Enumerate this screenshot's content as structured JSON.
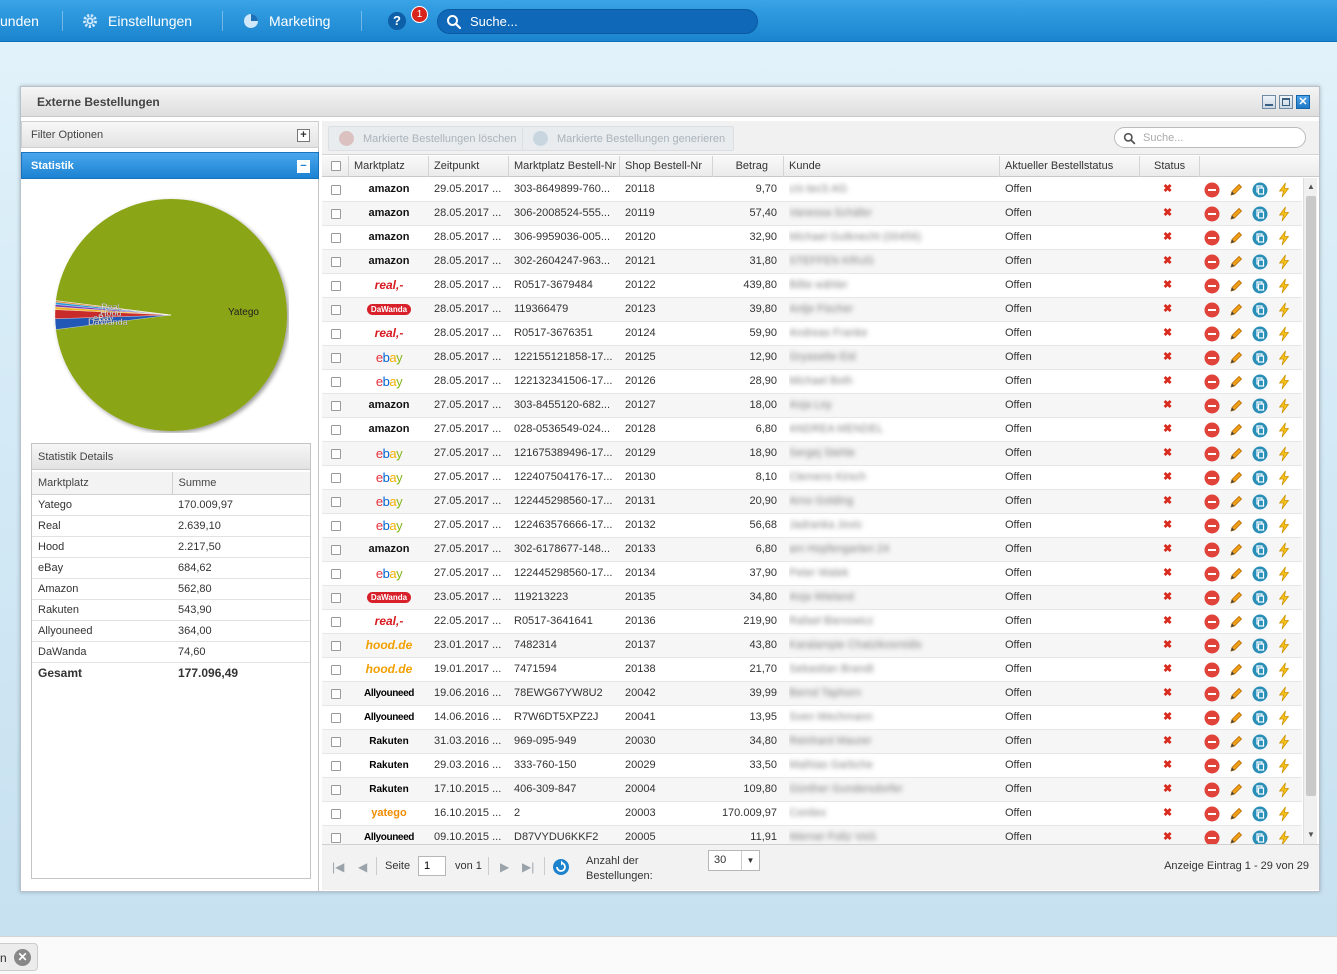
{
  "nav": {
    "items": [
      {
        "label": "unden",
        "icon": "people-icon"
      },
      {
        "label": "Einstellungen",
        "icon": "gear-icon"
      },
      {
        "label": "Marketing",
        "icon": "pie-chart-icon"
      }
    ],
    "notifications": "1",
    "help_icon": "?",
    "search_placeholder": "Suche..."
  },
  "window": {
    "title": "Externe Bestellungen",
    "close_glyph": "✕"
  },
  "left": {
    "filter_title": "Filter Optionen",
    "filter_toggle": "+",
    "stat_title": "Statistik",
    "stat_toggle": "−",
    "pie_labels": {
      "main": "Yatego",
      "small": [
        "Real",
        "Hood",
        "eBay",
        "DaWanda"
      ]
    },
    "details_title": "Statistik Details",
    "details_cols": [
      "Marktplatz",
      "Summe"
    ],
    "details_rows": [
      [
        "Yatego",
        "170.009,97"
      ],
      [
        "Real",
        "2.639,10"
      ],
      [
        "Hood",
        "2.217,50"
      ],
      [
        "eBay",
        "684,62"
      ],
      [
        "Amazon",
        "562,80"
      ],
      [
        "Rakuten",
        "543,90"
      ],
      [
        "Allyouneed",
        "364,00"
      ],
      [
        "DaWanda",
        "74,60"
      ]
    ],
    "total_label": "Gesamt",
    "total_value": "177.096,49"
  },
  "chart_data": {
    "type": "pie",
    "categories": [
      "Yatego",
      "Real",
      "Hood",
      "eBay",
      "Amazon",
      "Rakuten",
      "Allyouneed",
      "DaWanda"
    ],
    "values": [
      170009.97,
      2639.1,
      2217.5,
      684.62,
      562.8,
      543.9,
      364.0,
      74.6
    ],
    "colors": [
      "#8aa513",
      "#2259b5",
      "#c92a2a",
      "#f0b429",
      "#7a3db8",
      "#2c9ad6",
      "#e07b20",
      "#777777"
    ]
  },
  "toolbar": {
    "delete_label": "Markierte Bestellungen löschen",
    "generate_label": "Markierte Bestellungen generieren",
    "search_placeholder": "Suche..."
  },
  "grid": {
    "columns": [
      "Marktplatz",
      "Zeitpunkt",
      "Marktplatz Bestell-Nr",
      "Shop Bestell-Nr",
      "Betrag",
      "Kunde",
      "Aktueller Bestellstatus",
      "Status"
    ],
    "status_mark": "✖",
    "rows": [
      {
        "mp": "amazon",
        "time": "29.05.2017 ...",
        "mpnr": "303-8649899-760...",
        "shopnr": "20118",
        "amount": "9,70",
        "customer": "c/o tecS AG",
        "status": "Offen"
      },
      {
        "mp": "amazon",
        "time": "28.05.2017 ...",
        "mpnr": "306-2008524-555...",
        "shopnr": "20119",
        "amount": "57,40",
        "customer": "Vanessa Schäfer",
        "status": "Offen"
      },
      {
        "mp": "amazon",
        "time": "28.05.2017 ...",
        "mpnr": "306-9959036-005...",
        "shopnr": "20120",
        "amount": "32,90",
        "customer": "Michael Gutknecht (00456)",
        "status": "Offen"
      },
      {
        "mp": "amazon",
        "time": "28.05.2017 ...",
        "mpnr": "302-2604247-963...",
        "shopnr": "20121",
        "amount": "31,80",
        "customer": "STEFFEN KRUG",
        "status": "Offen"
      },
      {
        "mp": "real",
        "time": "28.05.2017 ...",
        "mpnr": "R0517-3679484",
        "shopnr": "20122",
        "amount": "439,80",
        "customer": "Billie wähler",
        "status": "Offen"
      },
      {
        "mp": "dawanda",
        "time": "28.05.2017 ...",
        "mpnr": "119366479",
        "shopnr": "20123",
        "amount": "39,80",
        "customer": "Antje Fischer",
        "status": "Offen"
      },
      {
        "mp": "real",
        "time": "28.05.2017 ...",
        "mpnr": "R0517-3676351",
        "shopnr": "20124",
        "amount": "59,90",
        "customer": "Andreas Franke",
        "status": "Offen"
      },
      {
        "mp": "ebay",
        "time": "28.05.2017 ...",
        "mpnr": "122155121858-17...",
        "shopnr": "20125",
        "amount": "12,90",
        "customer": "Gryasette Eid",
        "status": "Offen"
      },
      {
        "mp": "ebay",
        "time": "28.05.2017 ...",
        "mpnr": "122132341506-17...",
        "shopnr": "20126",
        "amount": "28,90",
        "customer": "Michael Both",
        "status": "Offen"
      },
      {
        "mp": "amazon",
        "time": "27.05.2017 ...",
        "mpnr": "303-8455120-682...",
        "shopnr": "20127",
        "amount": "18,00",
        "customer": "Anja Loy",
        "status": "Offen"
      },
      {
        "mp": "amazon",
        "time": "27.05.2017 ...",
        "mpnr": "028-0536549-024...",
        "shopnr": "20128",
        "amount": "6,80",
        "customer": "ANDREA MENDEL",
        "status": "Offen"
      },
      {
        "mp": "ebay",
        "time": "27.05.2017 ...",
        "mpnr": "121675389496-17...",
        "shopnr": "20129",
        "amount": "18,90",
        "customer": "Sergej Stehle",
        "status": "Offen"
      },
      {
        "mp": "ebay",
        "time": "27.05.2017 ...",
        "mpnr": "122407504176-17...",
        "shopnr": "20130",
        "amount": "8,10",
        "customer": "Clemens Kirsch",
        "status": "Offen"
      },
      {
        "mp": "ebay",
        "time": "27.05.2017 ...",
        "mpnr": "122445298560-17...",
        "shopnr": "20131",
        "amount": "20,90",
        "customer": "Arno Golding",
        "status": "Offen"
      },
      {
        "mp": "ebay",
        "time": "27.05.2017 ...",
        "mpnr": "122463576666-17...",
        "shopnr": "20132",
        "amount": "56,68",
        "customer": "Jadranka Jovic",
        "status": "Offen"
      },
      {
        "mp": "amazon",
        "time": "27.05.2017 ...",
        "mpnr": "302-6178677-148...",
        "shopnr": "20133",
        "amount": "6,80",
        "customer": "am Hopfengarten 24",
        "status": "Offen"
      },
      {
        "mp": "ebay",
        "time": "27.05.2017 ...",
        "mpnr": "122445298560-17...",
        "shopnr": "20134",
        "amount": "37,90",
        "customer": "Peter Walek",
        "status": "Offen"
      },
      {
        "mp": "dawanda",
        "time": "23.05.2017 ...",
        "mpnr": "119213223",
        "shopnr": "20135",
        "amount": "34,80",
        "customer": "Anja Wieland",
        "status": "Offen"
      },
      {
        "mp": "real",
        "time": "22.05.2017 ...",
        "mpnr": "R0517-3641641",
        "shopnr": "20136",
        "amount": "219,90",
        "customer": "Rafael Bienowicz",
        "status": "Offen"
      },
      {
        "mp": "hood",
        "time": "23.01.2017 ...",
        "mpnr": "7482314",
        "shopnr": "20137",
        "amount": "43,80",
        "customer": "Karalampie Chatzikosmidis",
        "status": "Offen"
      },
      {
        "mp": "hood",
        "time": "19.01.2017 ...",
        "mpnr": "7471594",
        "shopnr": "20138",
        "amount": "21,70",
        "customer": "Sebastian Brandt",
        "status": "Offen"
      },
      {
        "mp": "allyouneed",
        "time": "19.06.2016 ...",
        "mpnr": "78EWG67YW8U2",
        "shopnr": "20042",
        "amount": "39,99",
        "customer": "Bernd Taphorn",
        "status": "Offen"
      },
      {
        "mp": "allyouneed",
        "time": "14.06.2016 ...",
        "mpnr": "R7W6DT5XPZ2J",
        "shopnr": "20041",
        "amount": "13,95",
        "customer": "Sven Wechmann",
        "status": "Offen"
      },
      {
        "mp": "rakuten",
        "time": "31.03.2016 ...",
        "mpnr": "969-095-949",
        "shopnr": "20030",
        "amount": "34,80",
        "customer": "Reinhard Maurer",
        "status": "Offen"
      },
      {
        "mp": "rakuten",
        "time": "29.03.2016 ...",
        "mpnr": "333-760-150",
        "shopnr": "20029",
        "amount": "33,50",
        "customer": "Mathias Garbche",
        "status": "Offen"
      },
      {
        "mp": "rakuten",
        "time": "17.10.2015 ...",
        "mpnr": "406-309-847",
        "shopnr": "20004",
        "amount": "109,80",
        "customer": "Günther Gundersdorfer",
        "status": "Offen"
      },
      {
        "mp": "yatego",
        "time": "16.10.2015 ...",
        "mpnr": "2",
        "shopnr": "20003",
        "amount": "170.009,97",
        "customer": "Conitex",
        "status": "Offen"
      },
      {
        "mp": "allyouneed",
        "time": "09.10.2015 ...",
        "mpnr": "D87VYDU6KKF2",
        "shopnr": "20005",
        "amount": "11,91",
        "customer": "Werner Foltz VoG",
        "status": "Offen"
      }
    ]
  },
  "logos": {
    "amazon": "amazon",
    "real": "real,-",
    "dawanda": "DaWanda",
    "ebay": "ebay",
    "hood": "hood.de",
    "allyouneed": "Allyouneed",
    "rakuten": "Rakuten",
    "yatego": "yatego"
  },
  "pager": {
    "page_label": "Seite",
    "page_value": "1",
    "of_label": "von 1",
    "count_label": "Anzahl der Bestellungen:",
    "count_value": "30",
    "info": "Anzeige Eintrag 1 - 29 von 29"
  },
  "bottom": {
    "tab_label": "n",
    "close_glyph": "✕"
  }
}
